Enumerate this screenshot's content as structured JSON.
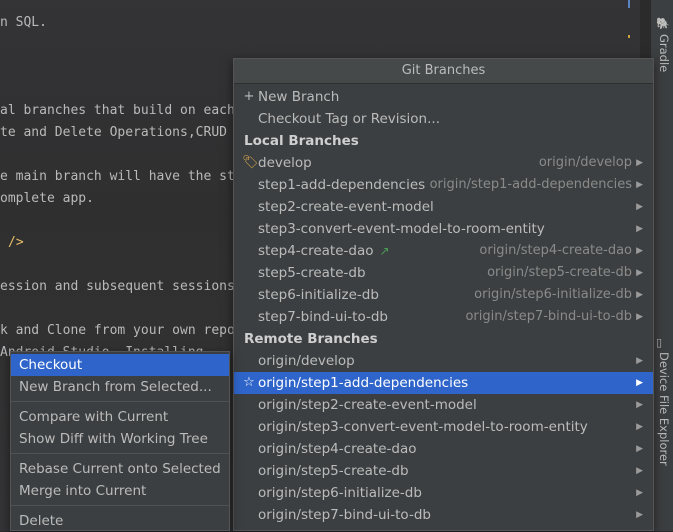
{
  "editor": {
    "lines": [
      "n SQL.",
      "al branches that build on each",
      "te and Delete Operations,CRUD",
      "e main branch will have the st",
      "omplete app.",
      "/>",
      "ession and subsequent sessions",
      "k and Clone from your own repo",
      "Android Studio. Installing"
    ]
  },
  "tool_strip": {
    "gradle_label": "Gradle",
    "device_file_explorer_label": "Device File Explorer"
  },
  "popup": {
    "title": "Git Branches",
    "actions": [
      {
        "icon": "+",
        "label": "New Branch"
      },
      {
        "icon": "",
        "label": "Checkout Tag or Revision..."
      }
    ],
    "local_header": "Local Branches",
    "local_branches": [
      {
        "name": "develop",
        "remote": "origin/develop",
        "icon": "tag-icon"
      },
      {
        "name": "step1-add-dependencies",
        "remote": "origin/step1-add-dependencies"
      },
      {
        "name": "step2-create-event-model",
        "remote": ""
      },
      {
        "name": "step3-convert-event-model-to-room-entity",
        "remote": ""
      },
      {
        "name": "step4-create-dao",
        "remote": "origin/step4-create-dao",
        "outgoing": "↗"
      },
      {
        "name": "step5-create-db",
        "remote": "origin/step5-create-db"
      },
      {
        "name": "step6-initialize-db",
        "remote": "origin/step6-initialize-db"
      },
      {
        "name": "step7-bind-ui-to-db",
        "remote": "origin/step7-bind-ui-to-db"
      }
    ],
    "remote_header": "Remote Branches",
    "remote_branches": [
      {
        "name": "origin/develop"
      },
      {
        "name": "origin/step1-add-dependencies",
        "selected": true,
        "icon": "star-icon"
      },
      {
        "name": "origin/step2-create-event-model"
      },
      {
        "name": "origin/step3-convert-event-model-to-room-entity"
      },
      {
        "name": "origin/step4-create-dao"
      },
      {
        "name": "origin/step5-create-db"
      },
      {
        "name": "origin/step6-initialize-db"
      },
      {
        "name": "origin/step7-bind-ui-to-db"
      }
    ]
  },
  "context_menu": {
    "checkout": "Checkout",
    "new_branch_from_selected": "New Branch from Selected...",
    "compare_with_current": "Compare with Current",
    "show_diff": "Show Diff with Working Tree",
    "rebase": "Rebase Current onto Selected",
    "merge": "Merge into Current",
    "delete": "Delete"
  },
  "colors": {
    "selection": "#2f65ca",
    "tag_icon": "#d2a54a",
    "outgoing_arrow": "#499c54"
  }
}
